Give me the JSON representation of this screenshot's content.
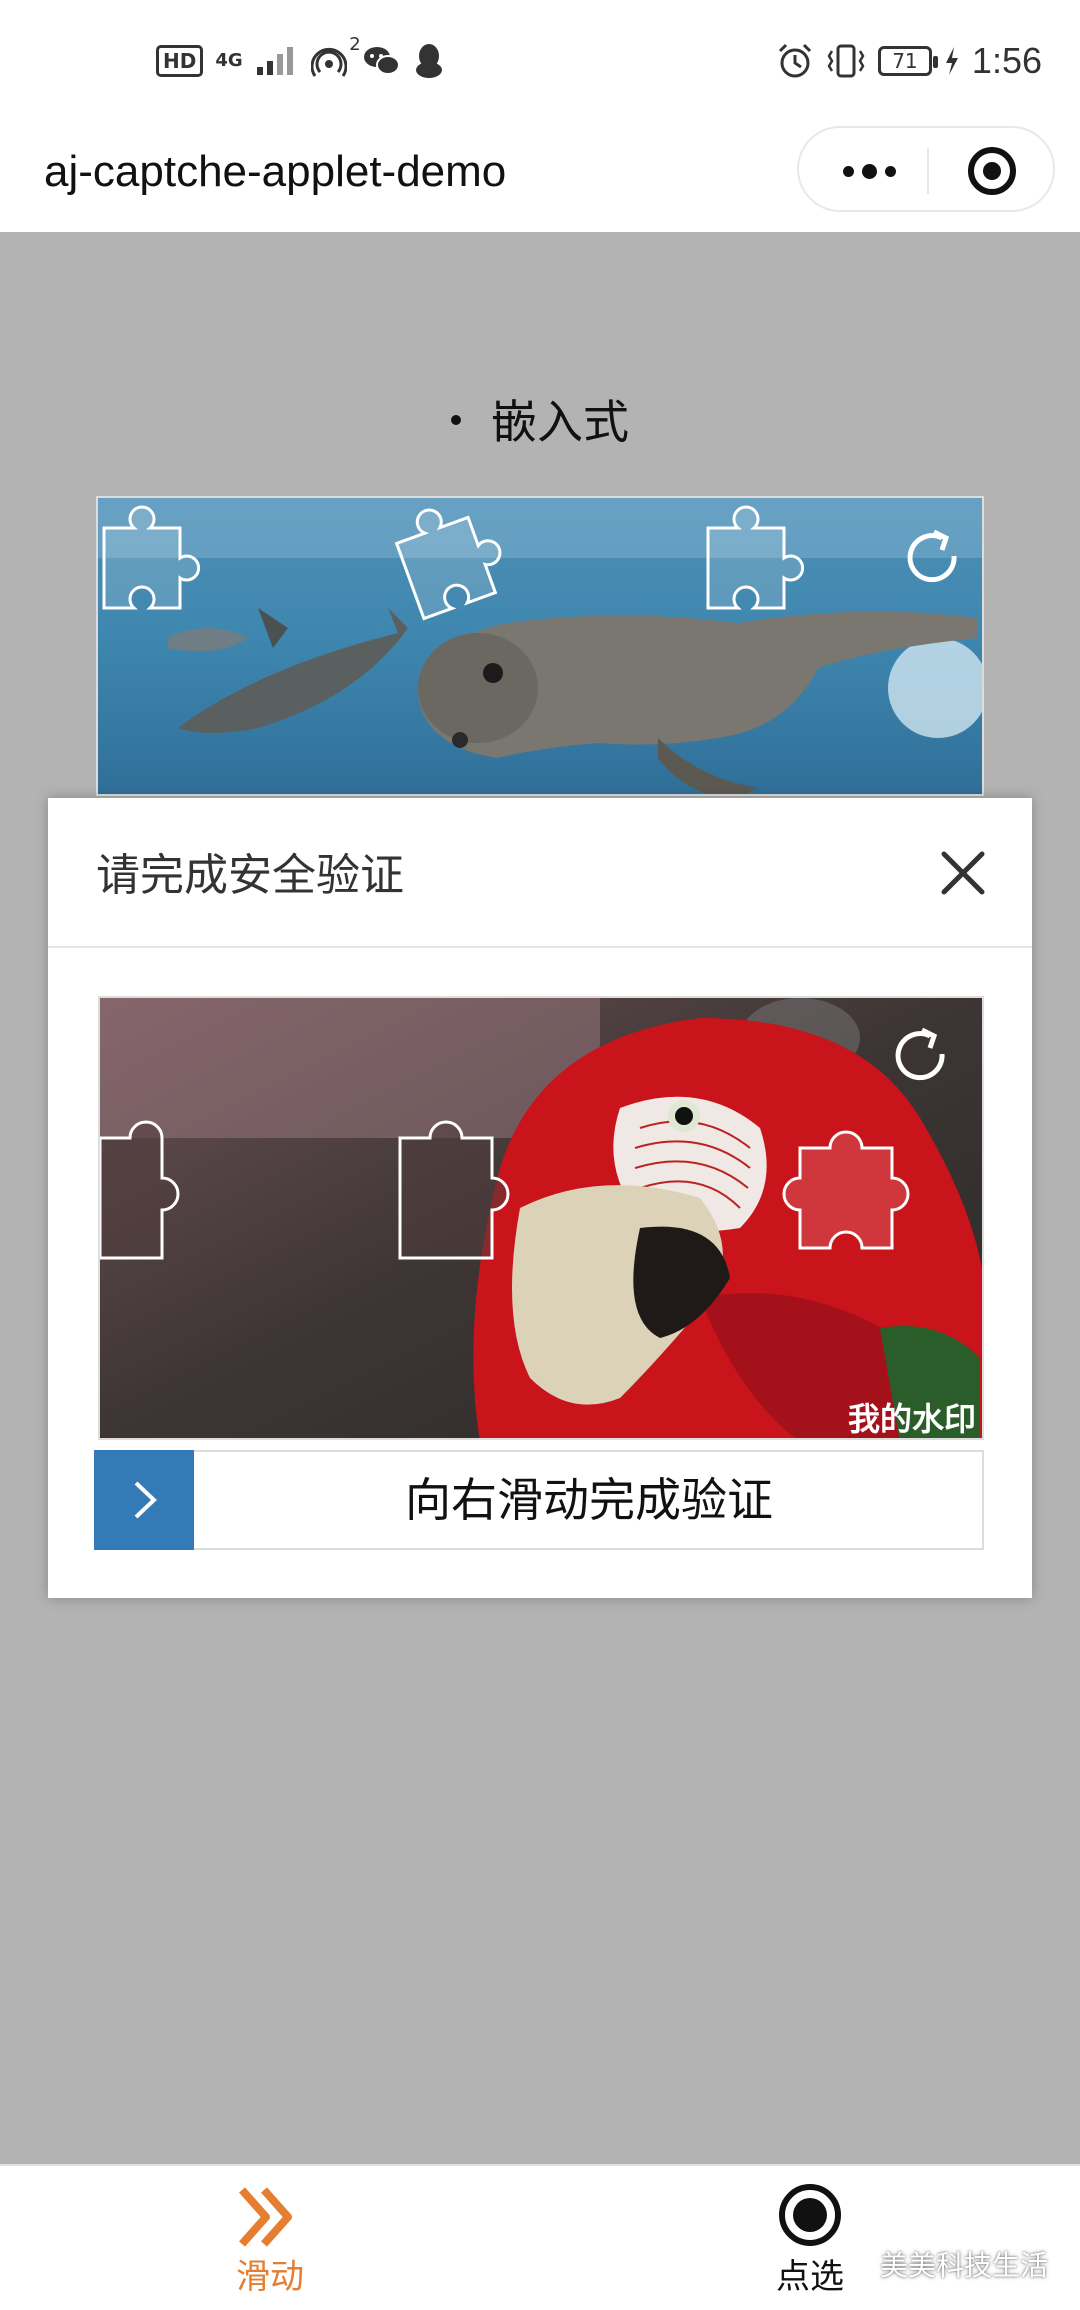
{
  "status_bar": {
    "hd": "HD",
    "network": "4G",
    "signal_badge": "2",
    "battery": "71",
    "time": "1:56"
  },
  "title_bar": {
    "title": "aj-captche-applet-demo"
  },
  "page": {
    "section_heading": "嵌入式"
  },
  "modal": {
    "title": "请完成安全验证",
    "watermark": "我的水印",
    "slider_text": "向右滑动完成验证"
  },
  "tabbar": {
    "tabs": [
      {
        "label": "滑动",
        "active": true
      },
      {
        "label": "点选",
        "active": false
      }
    ]
  },
  "overlay_watermark": "美美科技生活",
  "colors": {
    "accent_orange": "#E67E32",
    "slider_blue": "#337AB7",
    "background_grey": "#B3B3B3"
  }
}
